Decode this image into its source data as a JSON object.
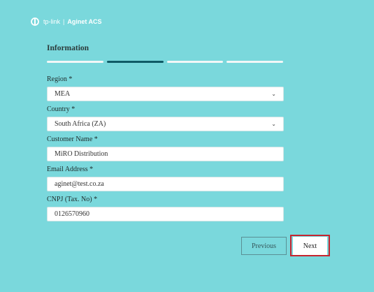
{
  "brand": {
    "logo_text": "tp-link",
    "separator": "|",
    "product": "Aginet ACS"
  },
  "page": {
    "title": "Information"
  },
  "steps": [
    {
      "active": false
    },
    {
      "active": true
    },
    {
      "active": false
    },
    {
      "active": false
    }
  ],
  "form": {
    "region": {
      "label": "Region *",
      "value": "MEA"
    },
    "country": {
      "label": "Country *",
      "value": "South Africa (ZA)"
    },
    "customer_name": {
      "label": "Customer Name *",
      "value": "MiRO Distribution"
    },
    "email": {
      "label": "Email Address *",
      "value": "aginet@test.co.za"
    },
    "cnpj": {
      "label": "CNPJ (Tax. No) *",
      "value": "0126570960"
    }
  },
  "buttons": {
    "previous": "Previous",
    "next": "Next"
  },
  "colors": {
    "background": "#7ad8dc",
    "active_step": "#0f5a66",
    "highlight": "#c6252f"
  },
  "icons": {
    "select_arrow": "chevron-down-icon",
    "logo": "tp-link-logo-icon"
  }
}
